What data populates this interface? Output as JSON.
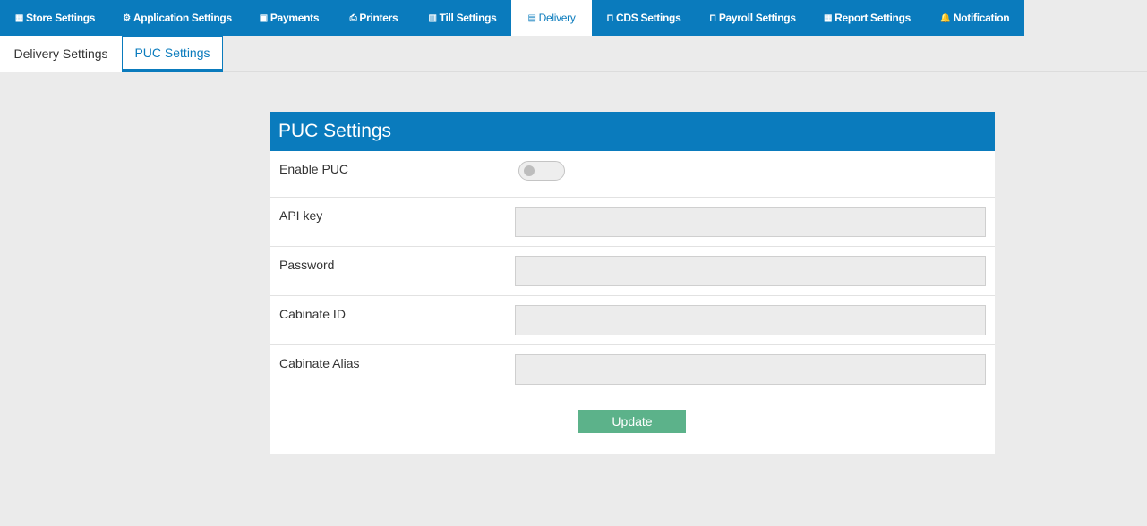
{
  "topnav": {
    "tabs": [
      {
        "icon": "store-icon",
        "glyph": "▦",
        "label": "Store Settings"
      },
      {
        "icon": "cogs-icon",
        "glyph": "⚙",
        "label": "Application Settings"
      },
      {
        "icon": "money-icon",
        "glyph": "▣",
        "label": "Payments"
      },
      {
        "icon": "printer-icon",
        "glyph": "⎙",
        "label": "Printers"
      },
      {
        "icon": "till-icon",
        "glyph": "▥",
        "label": "Till Settings"
      },
      {
        "icon": "delivery-icon",
        "glyph": "▤",
        "label": "Delivery"
      },
      {
        "icon": "cds-icon",
        "glyph": "⊓",
        "label": "CDS Settings"
      },
      {
        "icon": "payroll-icon",
        "glyph": "⊓",
        "label": "Payroll Settings"
      },
      {
        "icon": "report-icon",
        "glyph": "▦",
        "label": "Report Settings"
      },
      {
        "icon": "bell-icon",
        "glyph": "🔔",
        "label": "Notification"
      }
    ],
    "active": "Delivery"
  },
  "subtabs": {
    "delivery_settings": "Delivery Settings",
    "puc_settings": "PUC Settings"
  },
  "panel": {
    "title": "PUC Settings",
    "enable_puc_label": "Enable PUC",
    "enable_puc_value": false,
    "api_key_label": "API key",
    "api_key_value": "",
    "password_label": "Password",
    "password_value": "",
    "cabinate_id_label": "Cabinate ID",
    "cabinate_id_value": "",
    "cabinate_alias_label": "Cabinate Alias",
    "cabinate_alias_value": "",
    "update_label": "Update"
  },
  "colors": {
    "brand": "#0a7bbd",
    "update_button": "#5cb28a",
    "background": "#ebebeb"
  }
}
